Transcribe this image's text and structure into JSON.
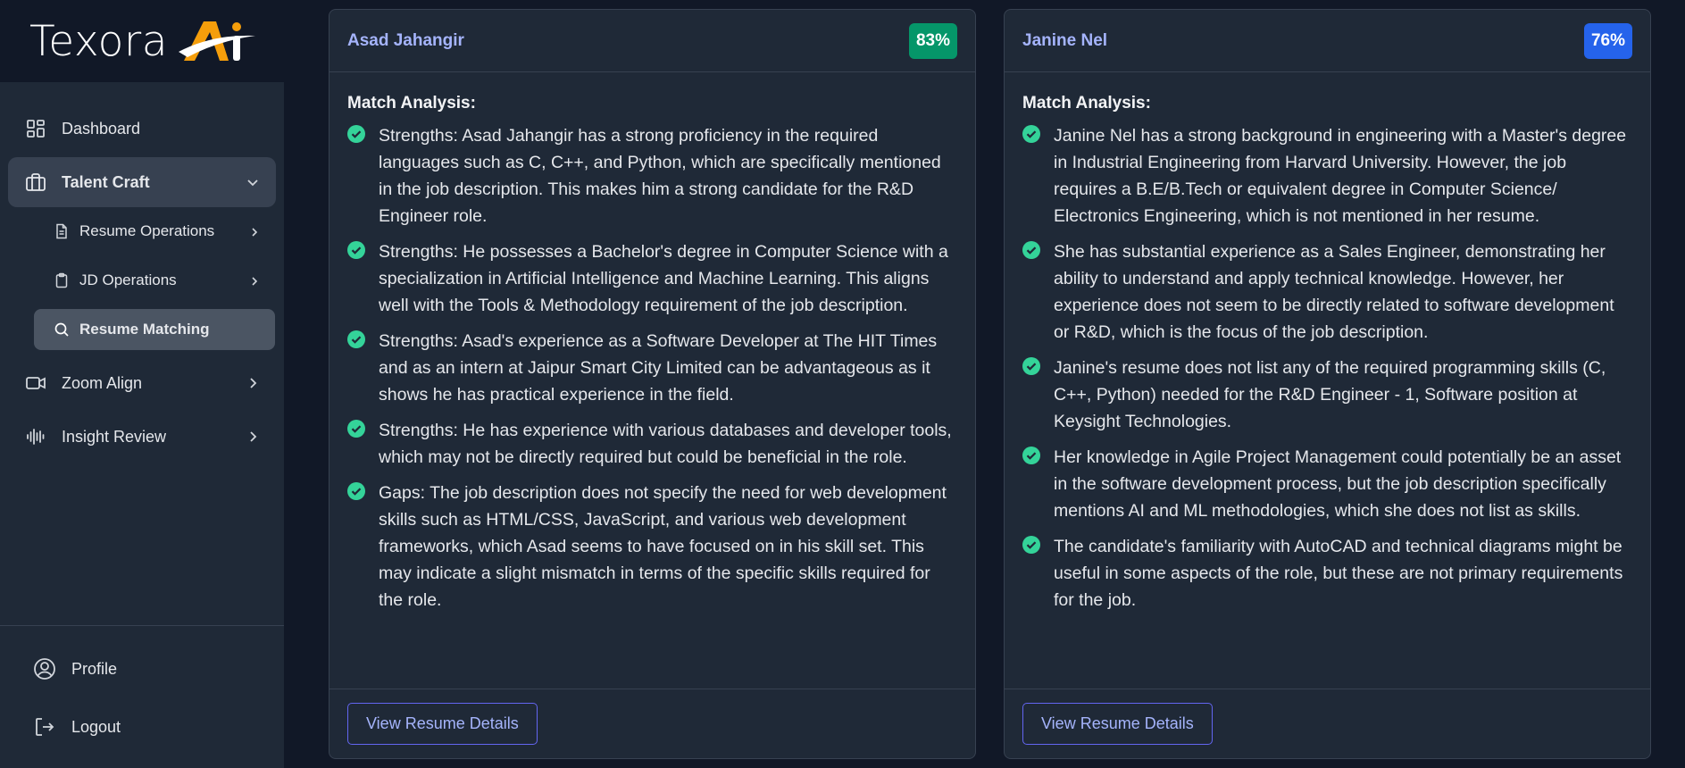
{
  "brand": {
    "name": "Texora",
    "mark": "Ai"
  },
  "colors": {
    "accent": "#a5b4fc",
    "score_green": "#059669",
    "score_blue": "#2563eb",
    "check": "#34d399",
    "logo_orange": "#f59e0b"
  },
  "sidebar": {
    "items": [
      {
        "label": "Dashboard",
        "icon": "dashboard-icon"
      },
      {
        "label": "Talent Craft",
        "icon": "briefcase-icon",
        "expanded": true
      },
      {
        "label": "Zoom Align",
        "icon": "video-icon"
      },
      {
        "label": "Insight Review",
        "icon": "waveform-icon"
      }
    ],
    "talent_craft_children": [
      {
        "label": "Resume Operations",
        "icon": "document-icon"
      },
      {
        "label": "JD Operations",
        "icon": "clipboard-icon"
      },
      {
        "label": "Resume Matching",
        "icon": "search-icon",
        "active": true
      }
    ],
    "bottom": [
      {
        "label": "Profile",
        "icon": "user-circle-icon"
      },
      {
        "label": "Logout",
        "icon": "logout-icon"
      }
    ]
  },
  "cards": [
    {
      "name": "Asad Jahangir",
      "score": "83%",
      "analysis_title": "Match Analysis:",
      "points": [
        "Strengths: Asad Jahangir has a strong proficiency in the required languages such as C, C++, and Python, which are specifically mentioned in the job description. This makes him a strong candidate for the R&D Engineer role.",
        "Strengths: He possesses a Bachelor's degree in Computer Science with a specialization in Artificial Intelligence and Machine Learning. This aligns well with the Tools & Methodology requirement of the job description.",
        "Strengths: Asad's experience as a Software Developer at The HIT Times and as an intern at Jaipur Smart City Limited can be advantageous as it shows he has practical experience in the field.",
        "Strengths: He has experience with various databases and developer tools, which may not be directly required but could be beneficial in the role.",
        "Gaps: The job description does not specify the need for web development skills such as HTML/CSS, JavaScript, and various web development frameworks, which Asad seems to have focused on in his skill set. This may indicate a slight mismatch in terms of the specific skills required for the role."
      ],
      "button": "View Resume Details"
    },
    {
      "name": "Janine Nel",
      "score": "76%",
      "analysis_title": "Match Analysis:",
      "points": [
        "Janine Nel has a strong background in engineering with a Master's degree in Industrial Engineering from Harvard University. However, the job requires a B.E/B.Tech or equivalent degree in Computer Science/ Electronics Engineering, which is not mentioned in her resume.",
        "She has substantial experience as a Sales Engineer, demonstrating her ability to understand and apply technical knowledge. However, her experience does not seem to be directly related to software development or R&D, which is the focus of the job description.",
        "Janine's resume does not list any of the required programming skills (C, C++, Python) needed for the R&D Engineer - 1, Software position at Keysight Technologies.",
        "Her knowledge in Agile Project Management could potentially be an asset in the software development process, but the job description specifically mentions AI and ML methodologies, which she does not list as skills.",
        "The candidate's familiarity with AutoCAD and technical diagrams might be useful in some aspects of the role, but these are not primary requirements for the job."
      ],
      "button": "View Resume Details"
    }
  ]
}
